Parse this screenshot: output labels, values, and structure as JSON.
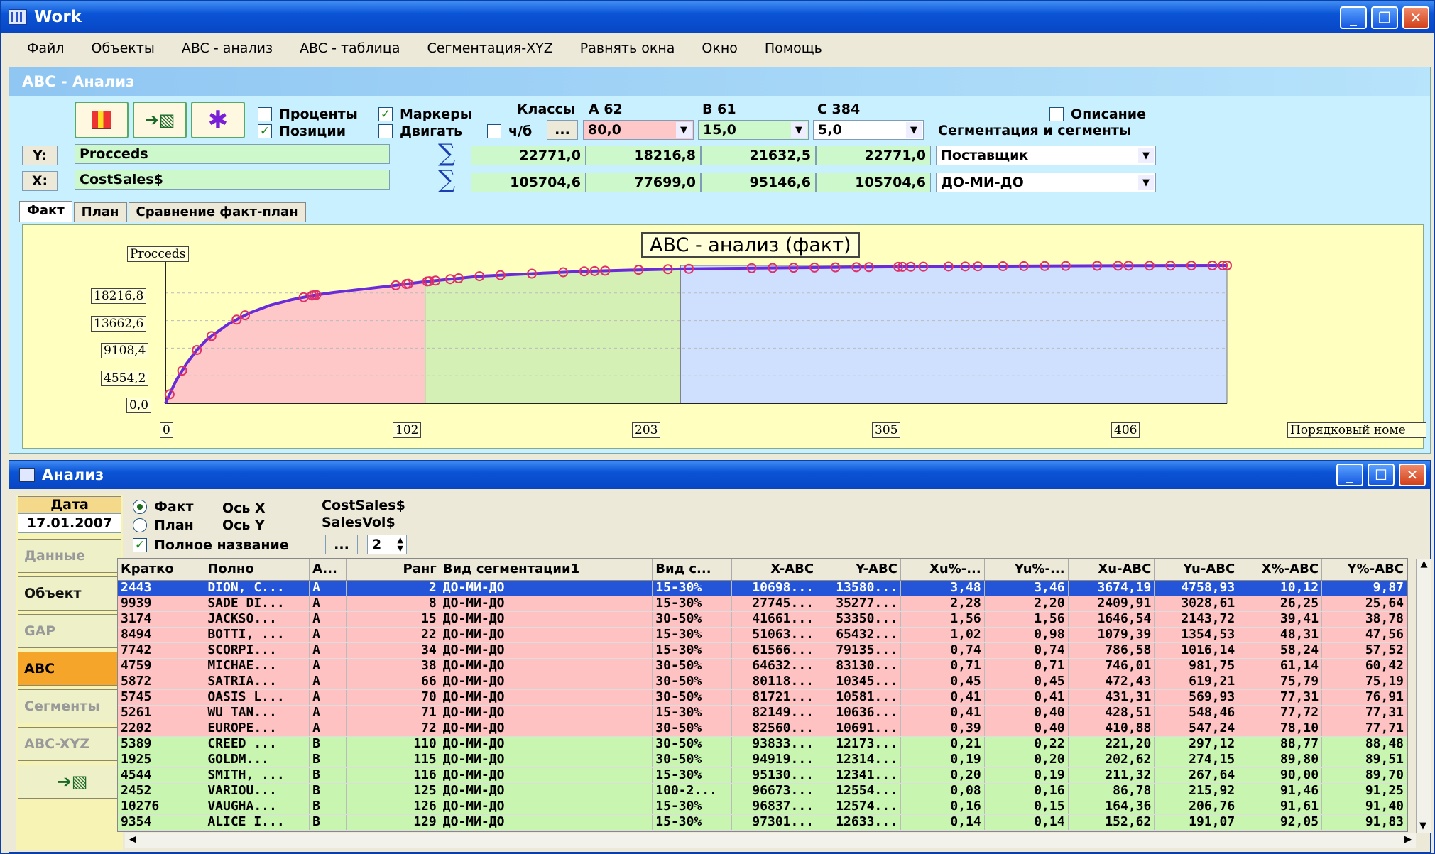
{
  "window": {
    "title": "Work",
    "min": "_",
    "restore": "❐",
    "close": "✕"
  },
  "menu": [
    "Файл",
    "Объекты",
    "ABC - анализ",
    "ABC - таблица",
    "Сегментация-XYZ",
    "Равнять окна",
    "Окно",
    "Помощь"
  ],
  "abc": {
    "title": "ABC - Анализ",
    "checks": {
      "percents": "Проценты",
      "positions": "Позиции",
      "markers": "Маркеры",
      "move": "Двигать",
      "ch6": "ч/б",
      "description": "Описание"
    },
    "classes_label": "Классы",
    "classA": "A   62",
    "classB": "B  61",
    "classC": "C   384",
    "ellipsis": "...",
    "thresholds": [
      "80,0",
      "15,0",
      "5,0"
    ],
    "segmentation_label": "Сегментация и сегменты",
    "y_btn": "Y:",
    "x_btn": "X:",
    "y_field": "Procceds",
    "x_field": "CostSales$",
    "sigma": "∑",
    "sum_y": [
      "22771,0",
      "18216,8",
      "21632,5",
      "22771,0"
    ],
    "sum_x": [
      "105704,6",
      "77699,0",
      "95146,6",
      "105704,6"
    ],
    "combo1": "Поставщик",
    "combo2": "ДО-МИ-ДО",
    "tabs": [
      "Факт",
      "План",
      "Сравнение факт-план"
    ]
  },
  "chart_data": {
    "type": "area",
    "title": "ABC - анализ (факт)",
    "ylabel": "Procceds",
    "xlabel": "Порядковый номе",
    "yticks": [
      "18216,8",
      "13662,6",
      "9108,4",
      "4554,2",
      "0,0"
    ],
    "xticks": [
      "0",
      "102",
      "203",
      "305",
      "406"
    ],
    "ylim": [
      0,
      22771
    ],
    "xlim": [
      0,
      507
    ],
    "zones": [
      {
        "class": "A",
        "from": 0,
        "to": 124,
        "color": "#ffc8c8"
      },
      {
        "class": "B",
        "from": 124,
        "to": 246,
        "color": "#d4f0b4"
      },
      {
        "class": "C",
        "from": 246,
        "to": 507,
        "color": "#cfe0ff"
      }
    ],
    "curve": {
      "x": [
        0,
        5,
        10,
        15,
        20,
        30,
        40,
        50,
        60,
        70,
        80,
        90,
        100,
        110,
        124,
        150,
        180,
        200,
        220,
        246,
        300,
        350,
        400,
        450,
        507
      ],
      "y": [
        0,
        3700,
        6500,
        8800,
        10600,
        13100,
        14900,
        16200,
        17100,
        17800,
        18300,
        18700,
        19100,
        19500,
        20100,
        21000,
        21500,
        21800,
        22000,
        22200,
        22400,
        22550,
        22650,
        22720,
        22771
      ]
    },
    "markers": [
      2,
      8,
      15,
      22,
      34,
      38,
      66,
      70,
      71,
      72,
      110,
      115,
      116,
      125,
      126,
      129,
      136,
      140,
      150,
      160,
      175,
      190,
      200,
      205,
      210,
      226,
      240,
      250,
      280,
      290,
      300,
      310,
      320,
      330,
      336,
      350,
      352,
      356,
      362,
      374,
      382,
      388,
      400,
      410,
      420,
      430,
      445,
      455,
      460,
      470,
      480,
      490,
      500,
      505,
      507
    ]
  },
  "analysis": {
    "title": "Анализ",
    "min": "_",
    "max": "☐",
    "close": "✕",
    "date_label": "Дата",
    "date_value": "17.01.2007",
    "sidebar": [
      "Данные",
      "Объект",
      "GAP",
      "ABC",
      "Сегменты",
      "ABC-XYZ"
    ],
    "radio_fact": "Факт",
    "radio_plan": "План",
    "axis_x": "Ось X",
    "axis_y": "Ось Y",
    "axis_x_val": "CostSales$",
    "axis_y_val": "SalesVol$",
    "full_name": "Полное название",
    "ellipsis": "...",
    "spin_value": "2",
    "columns": [
      "Кратко",
      "Полно",
      "A...",
      "Ранг",
      "Вид сегментации1",
      "Вид с...",
      "X-ABC",
      "Y-ABC",
      "Xu%-...",
      "Yu%-...",
      "Xu-ABC",
      "Yu-ABC",
      "X%-ABC",
      "Y%-ABC"
    ],
    "rows": [
      [
        "2443",
        "DION, C...",
        "A",
        "2",
        "ДО-МИ-ДО",
        "15-30%",
        "10698...",
        "13580...",
        "3,48",
        "3,46",
        "3674,19",
        "4758,93",
        "10,12",
        "9,87"
      ],
      [
        "9939",
        "SADE DI...",
        "A",
        "8",
        "ДО-МИ-ДО",
        "15-30%",
        "27745...",
        "35277...",
        "2,28",
        "2,20",
        "2409,91",
        "3028,61",
        "26,25",
        "25,64"
      ],
      [
        "3174",
        "JACKSO...",
        "A",
        "15",
        "ДО-МИ-ДО",
        "30-50%",
        "41661...",
        "53350...",
        "1,56",
        "1,56",
        "1646,54",
        "2143,72",
        "39,41",
        "38,78"
      ],
      [
        "8494",
        "BOTTI, ...",
        "A",
        "22",
        "ДО-МИ-ДО",
        "15-30%",
        "51063...",
        "65432...",
        "1,02",
        "0,98",
        "1079,39",
        "1354,53",
        "48,31",
        "47,56"
      ],
      [
        "7742",
        "SCORPI...",
        "A",
        "34",
        "ДО-МИ-ДО",
        "15-30%",
        "61566...",
        "79135...",
        "0,74",
        "0,74",
        "786,58",
        "1016,14",
        "58,24",
        "57,52"
      ],
      [
        "4759",
        "MICHAE...",
        "A",
        "38",
        "ДО-МИ-ДО",
        "30-50%",
        "64632...",
        "83130...",
        "0,71",
        "0,71",
        "746,01",
        "981,75",
        "61,14",
        "60,42"
      ],
      [
        "5872",
        "SATRIA...",
        "A",
        "66",
        "ДО-МИ-ДО",
        "30-50%",
        "80118...",
        "10345...",
        "0,45",
        "0,45",
        "472,43",
        "619,21",
        "75,79",
        "75,19"
      ],
      [
        "5745",
        "OASIS L...",
        "A",
        "70",
        "ДО-МИ-ДО",
        "30-50%",
        "81721...",
        "10581...",
        "0,41",
        "0,41",
        "431,31",
        "569,93",
        "77,31",
        "76,91"
      ],
      [
        "5261",
        "WU TAN...",
        "A",
        "71",
        "ДО-МИ-ДО",
        "15-30%",
        "82149...",
        "10636...",
        "0,41",
        "0,40",
        "428,51",
        "548,46",
        "77,72",
        "77,31"
      ],
      [
        "2202",
        "EUROPE...",
        "A",
        "72",
        "ДО-МИ-ДО",
        "30-50%",
        "82560...",
        "10691...",
        "0,39",
        "0,40",
        "410,88",
        "547,24",
        "78,10",
        "77,71"
      ],
      [
        "5389",
        "CREED ...",
        "B",
        "110",
        "ДО-МИ-ДО",
        "30-50%",
        "93833...",
        "12173...",
        "0,21",
        "0,22",
        "221,20",
        "297,12",
        "88,77",
        "88,48"
      ],
      [
        "1925",
        "GOLDM...",
        "B",
        "115",
        "ДО-МИ-ДО",
        "30-50%",
        "94919...",
        "12314...",
        "0,19",
        "0,20",
        "202,62",
        "274,15",
        "89,80",
        "89,51"
      ],
      [
        "4544",
        "SMITH, ...",
        "B",
        "116",
        "ДО-МИ-ДО",
        "15-30%",
        "95130...",
        "12341...",
        "0,20",
        "0,19",
        "211,32",
        "267,64",
        "90,00",
        "89,70"
      ],
      [
        "2452",
        "VARIOU...",
        "B",
        "125",
        "ДО-МИ-ДО",
        "100-2...",
        "96673...",
        "12554...",
        "0,08",
        "0,16",
        "86,78",
        "215,92",
        "91,46",
        "91,25"
      ],
      [
        "10276",
        "VAUGHA...",
        "B",
        "126",
        "ДО-МИ-ДО",
        "15-30%",
        "96837...",
        "12574...",
        "0,16",
        "0,15",
        "164,36",
        "206,76",
        "91,61",
        "91,40"
      ],
      [
        "9354",
        "ALICE I...",
        "B",
        "129",
        "ДО-МИ-ДО",
        "15-30%",
        "97301...",
        "12633...",
        "0,14",
        "0,14",
        "152,62",
        "191,07",
        "92,05",
        "91,83"
      ]
    ]
  }
}
